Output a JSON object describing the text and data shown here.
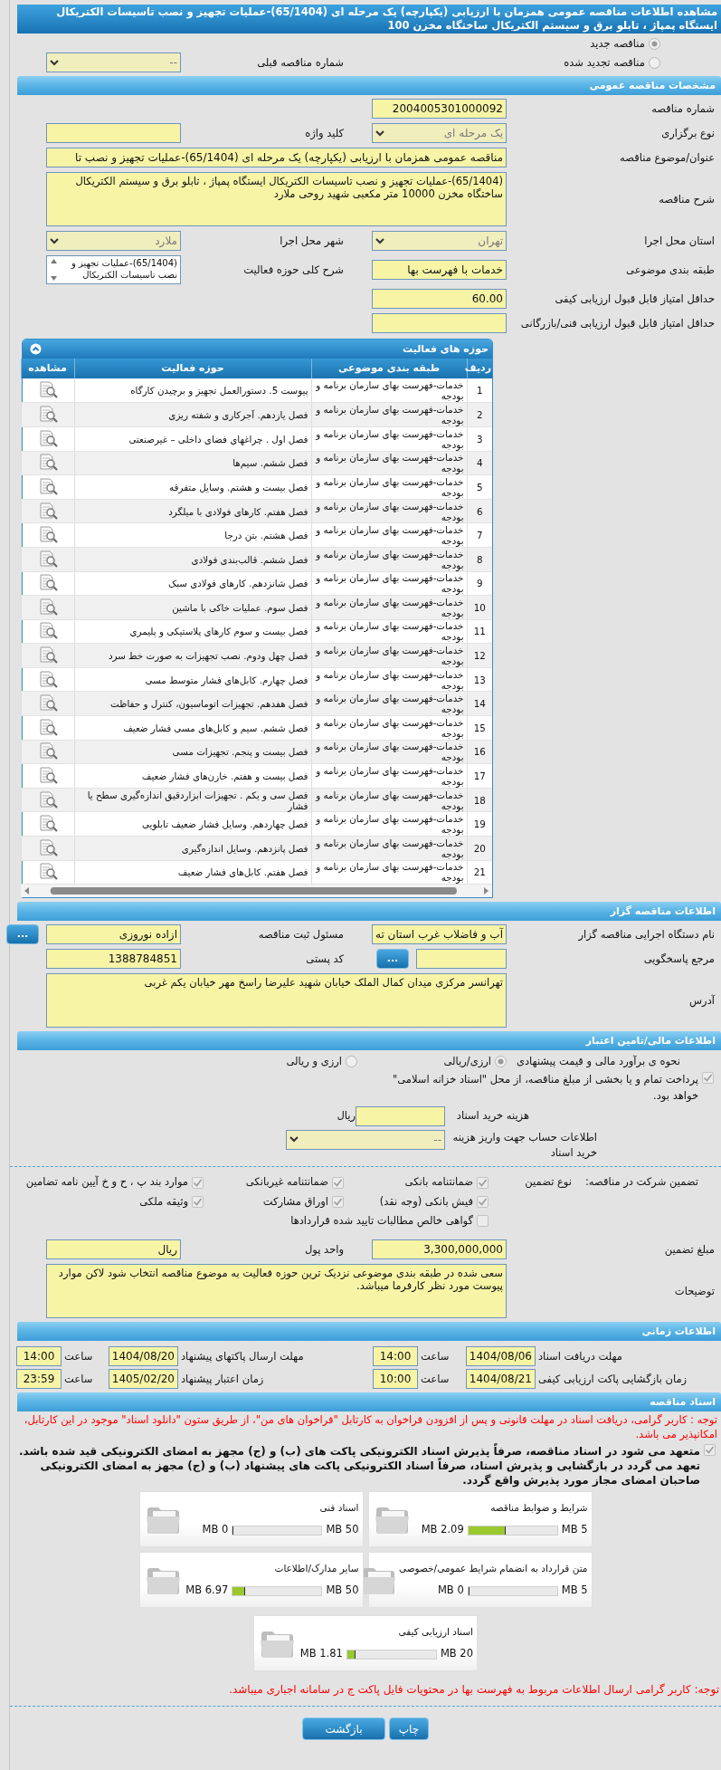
{
  "title": "مشاهده اطلاعات مناقصه عمومی همزمان با ارزیابی (یکپارچه) یک مرحله ای (65/1404)-عملیات تجهیز و نصب تاسیسات الکتریکال ایستگاه پمپاژ ، تابلو برق و سیستم الکتریکال ساختگاه مخزن 100",
  "tender_kind": [
    {
      "label": "مناقصه جدید",
      "selected": true
    },
    {
      "label": "مناقصه تجدید شده",
      "selected": false
    }
  ],
  "previous_tender": {
    "label": "شماره مناقصه قبلی",
    "value": "--"
  },
  "general": {
    "header": "مشخصات مناقصه عمومی",
    "rows": [
      [
        {
          "label": "شماره مناقصه",
          "value": "2004005301000092",
          "kind": "text"
        }
      ],
      [
        {
          "label": "نوع برگزاری",
          "value": "یک مرحله ای",
          "kind": "select"
        },
        {
          "label": "کلید واژه",
          "kind": "text"
        }
      ],
      [
        {
          "label": "عنوان/موضوع مناقصه",
          "value": "مناقصه عمومی همزمان با ارزیابی (یکپارچه) یک مرحله ای (65/1404)-عملیات تجهیز و نصب تا",
          "kind": "text",
          "wide": true
        }
      ],
      [
        {
          "label": "شرح مناقصه",
          "value": "(65/1404)-عملیات تجهیز و نصب تاسیسات الکتریکال ایستگاه پمپاژ ، تابلو برق و سیستم الکتریکال ساختگاه مخزن 10000 متر مکعبی شهید روحی ملارد",
          "kind": "textarea"
        }
      ],
      [
        {
          "label": "استان محل اجرا",
          "value": "تهران",
          "kind": "select"
        },
        {
          "label": "شهر محل اجرا",
          "value": "ملارد",
          "kind": "select"
        }
      ],
      [
        {
          "label": "طبقه بندی موضوعی",
          "value": "خدمات با فهرست بها",
          "kind": "text"
        },
        {
          "label": "شرح کلی حوزه فعالیت",
          "value": "(65/1404)-عملیات تجهیز و نصب تاسیسات الکتریکال",
          "kind": "listbox"
        }
      ],
      [
        {
          "label": "حداقل امتیاز قابل قبول ارزیابی کیفی",
          "value": "60.00",
          "kind": "text"
        }
      ],
      [
        {
          "label": "حداقل امتیاز قابل قبول ارزیابی فنی/بازرگانی",
          "kind": "text"
        }
      ]
    ]
  },
  "activities": {
    "header": "حوزه های فعالیت",
    "columns": [
      "ردیف",
      "طبقه بندی موضوعی",
      "حوزه فعالیت",
      "مشاهده"
    ],
    "rows": [
      {
        "no": "1",
        "category": "خدمات-فهرست بهای سازمان برنامه و بودجه",
        "activity": "پیوست 5. دستورالعمل تجهیز و برچیدن کارگاه"
      },
      {
        "no": "2",
        "category": "خدمات-فهرست بهای سازمان برنامه و بودجه",
        "activity": "فصل یازدهم. آجرکاری و شفته ریزی"
      },
      {
        "no": "3",
        "category": "خدمات-فهرست بهای سازمان برنامه و بودجه",
        "activity": "فصل اول . چراغهای فضای داخلی – غیرصنعتی"
      },
      {
        "no": "4",
        "category": "خدمات-فهرست بهای سازمان برنامه و بودجه",
        "activity": "فصل ششم. سیم‌ها"
      },
      {
        "no": "5",
        "category": "خدمات-فهرست بهای سازمان برنامه و بودجه",
        "activity": "فصل بیست و هشتم. وسایل متفرقه"
      },
      {
        "no": "6",
        "category": "خدمات-فهرست بهای سازمان برنامه و بودجه",
        "activity": "فصل هفتم. کارهای فولادی با میلگرد"
      },
      {
        "no": "7",
        "category": "خدمات-فهرست بهای سازمان برنامه و بودجه",
        "activity": "فصل هشتم. بتن درجا"
      },
      {
        "no": "8",
        "category": "خدمات-فهرست بهای سازمان برنامه و بودجه",
        "activity": "فصل ششم. قالب‌بندی فولادی"
      },
      {
        "no": "9",
        "category": "خدمات-فهرست بهای سازمان برنامه و بودجه",
        "activity": "فصل شانزدهم. کارهای فولادی سبک"
      },
      {
        "no": "10",
        "category": "خدمات-فهرست بهای سازمان برنامه و بودجه",
        "activity": "فصل سوم. عملیات خاکی با ماشین"
      },
      {
        "no": "11",
        "category": "خدمات-فهرست بهای سازمان برنامه و بودجه",
        "activity": "فصل بیست و سوم کارهای پلاستیکی و پلیمری"
      },
      {
        "no": "12",
        "category": "خدمات-فهرست بهای سازمان برنامه و بودجه",
        "activity": "فصل چهل ودوم. نصب تجهیزات به صورت خط سرد"
      },
      {
        "no": "13",
        "category": "خدمات-فهرست بهای سازمان برنامه و بودجه",
        "activity": "فصل چهارم. کابل‌های فشار متوسط مسی"
      },
      {
        "no": "14",
        "category": "خدمات-فهرست بهای سازمان برنامه و بودجه",
        "activity": "فصل هفدهم. تجهیزات اتوماسیون، کنترل و حفاظت"
      },
      {
        "no": "15",
        "category": "خدمات-فهرست بهای سازمان برنامه و بودجه",
        "activity": "فصل ششم. سیم و کابل‌های مسی فشار ضعیف"
      },
      {
        "no": "16",
        "category": "خدمات-فهرست بهای سازمان برنامه و بودجه",
        "activity": "فصل بیست و پنجم. تجهیزات مسی"
      },
      {
        "no": "17",
        "category": "خدمات-فهرست بهای سازمان برنامه و بودجه",
        "activity": "فصل بیست و هفتم. خازن‌های فشار ضعیف"
      },
      {
        "no": "18",
        "category": "خدمات-فهرست بهای سازمان برنامه و بودجه",
        "activity": "فصل سی و یکم . تجهیزات ابزاردقیق اندازه‌گیری سطح یا فشار"
      },
      {
        "no": "19",
        "category": "خدمات-فهرست بهای سازمان برنامه و بودجه",
        "activity": "فصل چهاردهم. وسایل فشار ضعیف تابلویی"
      },
      {
        "no": "20",
        "category": "خدمات-فهرست بهای سازمان برنامه و بودجه",
        "activity": "فصل پانزدهم. وسایل اندازه‌گیری"
      },
      {
        "no": "21",
        "category": "خدمات-فهرست بهای سازمان برنامه و بودجه",
        "activity": "فصل هفتم. کابل‌های فشار ضعیف"
      }
    ]
  },
  "organizer": {
    "header": "اطلاعات مناقصه گزار",
    "rows": [
      [
        {
          "label": "نام دستگاه اجرایی مناقصه گزار",
          "value": "آب و فاضلاب غرب استان ته",
          "kind": "text"
        },
        {
          "label": "مسئول ثبت مناقصه",
          "value": "ازاده نوروزی",
          "kind": "text",
          "button": "..."
        }
      ],
      [
        {
          "label": "مرجع پاسخگویی",
          "kind": "text",
          "button": "..."
        },
        {
          "label": "کد پستی",
          "value": "1388784851",
          "kind": "text"
        }
      ],
      [
        {
          "label": "آدرس",
          "value": "تهرانسر مرکزی میدان کمال الملک خیابان شهید علیرضا راسخ مهر خیابان یکم غربی",
          "kind": "textarea"
        }
      ]
    ]
  },
  "finance": {
    "header": "اطلاعات مالی/تامین اعتبار",
    "estimate": {
      "label": "نحوه ی برآورد مالی و قیمت پیشنهادی",
      "options": [
        {
          "label": "ارزی/ریالی",
          "selected": true
        },
        {
          "label": "ارزی و ریالی",
          "selected": false
        }
      ]
    },
    "treasury": {
      "label": "پرداخت تمام و یا بخشی از مبلغ مناقصه، از محل \"اسناد خزانه اسلامی\" خواهد بود.",
      "checked": true
    },
    "doc_cost": {
      "label": "هزینه خرید اسناد",
      "unit": "ریال"
    },
    "account": {
      "label": "اطلاعات حساب جهت واریز هزینه خرید اسناد",
      "value": "--"
    },
    "guarantee": {
      "label": "تضمین شرکت در مناقصه:",
      "type_label": "نوع تضمین",
      "options": [
        {
          "label": "ضمانتنامه بانکی",
          "checked": true
        },
        {
          "label": "ضمانتنامه غیربانکی",
          "checked": true
        },
        {
          "label": "موارد بند پ ، ح و خ آیین نامه تضامین",
          "checked": true
        },
        {
          "label": "فیش بانکی (وجه نقد)",
          "checked": true
        },
        {
          "label": "اوراق مشارکت",
          "checked": true
        },
        {
          "label": "وثیقه ملکی",
          "checked": true
        },
        {
          "label": "گواهی خالص مطالبات تایید شده قراردادها",
          "checked": false
        }
      ]
    },
    "rows": [
      [
        {
          "label": "مبلغ تضمین",
          "value": "3,300,000,000",
          "kind": "text"
        },
        {
          "label": "واحد پول",
          "value": "ریال",
          "kind": "text"
        }
      ],
      [
        {
          "label": "توضیحات",
          "value": "سعی شده در طبقه بندی موضوعی نزدیک ترین حوزه فعالیت به موضوع مناقصه انتخاب شود لاکن موارد پیوست مورد نظر کارفرما میباشد.",
          "kind": "textarea"
        }
      ]
    ]
  },
  "schedule": {
    "header": "اطلاعات زمانی",
    "items": [
      {
        "label": "مهلت دریافت اسناد",
        "date": "1404/08/06",
        "time_label": "ساعت",
        "time": "14:00"
      },
      {
        "label": "مهلت ارسال پاکتهای پیشنهاد",
        "date": "1404/08/20",
        "time_label": "ساعت",
        "time": "14:00"
      },
      {
        "label": "زمان بازگشایی پاکت ارزیابی کیفی",
        "date": "1404/08/21",
        "time_label": "ساعت",
        "time": "10:00"
      },
      {
        "label": "زمان اعتبار پیشنهاد",
        "date": "1405/02/20",
        "time_label": "ساعت",
        "time": "23:59"
      }
    ]
  },
  "documents": {
    "header": "اسناد مناقصه",
    "notice": "توجه : کاربر گرامی، دریافت اسناد در مهلت قانونی و پس از افزودن فراخوان به کارتابل \"فراخوان های من\"، از طریق ستون \"دانلود اسناد\" موجود در این کارتابل، امکانپذیر می باشد.",
    "commitment": {
      "text": "متعهد می شود در اسناد مناقصه، صرفاً پذیرش اسناد الکترونیکی پاکت های (ب) و (ج) مجهز به امضای الکترونیکی قید شده باشد. تعهد می گردد در بازگشایی و پذیرش اسناد، صرفاً اسناد الکترونیکی پاکت های پیشنهاد (ب) و (ج) مجهز به امضای الکترونیکی صاحبان امضای مجاز مورد پذیرش واقع گردد.",
      "checked": true
    },
    "files": [
      {
        "title": "شرایط و ضوابط مناقصه",
        "used": "2.09 MB",
        "max": "5 MB",
        "level": 0.418
      },
      {
        "title": "اسناد فنی",
        "used": "0 MB",
        "max": "50 MB",
        "level": 0
      },
      {
        "title": "متن قرارداد به انضمام شرایط عمومی/خصوصی",
        "used": "0 MB",
        "max": "5 MB",
        "level": 0
      },
      {
        "title": "سایر مدارک/اطلاعات",
        "used": "6.97 MB",
        "max": "50 MB",
        "level": 0.139
      },
      {
        "title": "اسناد ارزیابی کیفی",
        "used": "1.81 MB",
        "max": "20 MB",
        "level": 0.09
      }
    ],
    "footnote": "توجه: کاربر گرامی ارسال اطلاعات مربوط به فهرست بها در محتویات فایل پاکت ج در سامانه اجباری میباشد."
  },
  "buttons": [
    {
      "label": "چاپ"
    },
    {
      "label": "بازگشت"
    }
  ]
}
